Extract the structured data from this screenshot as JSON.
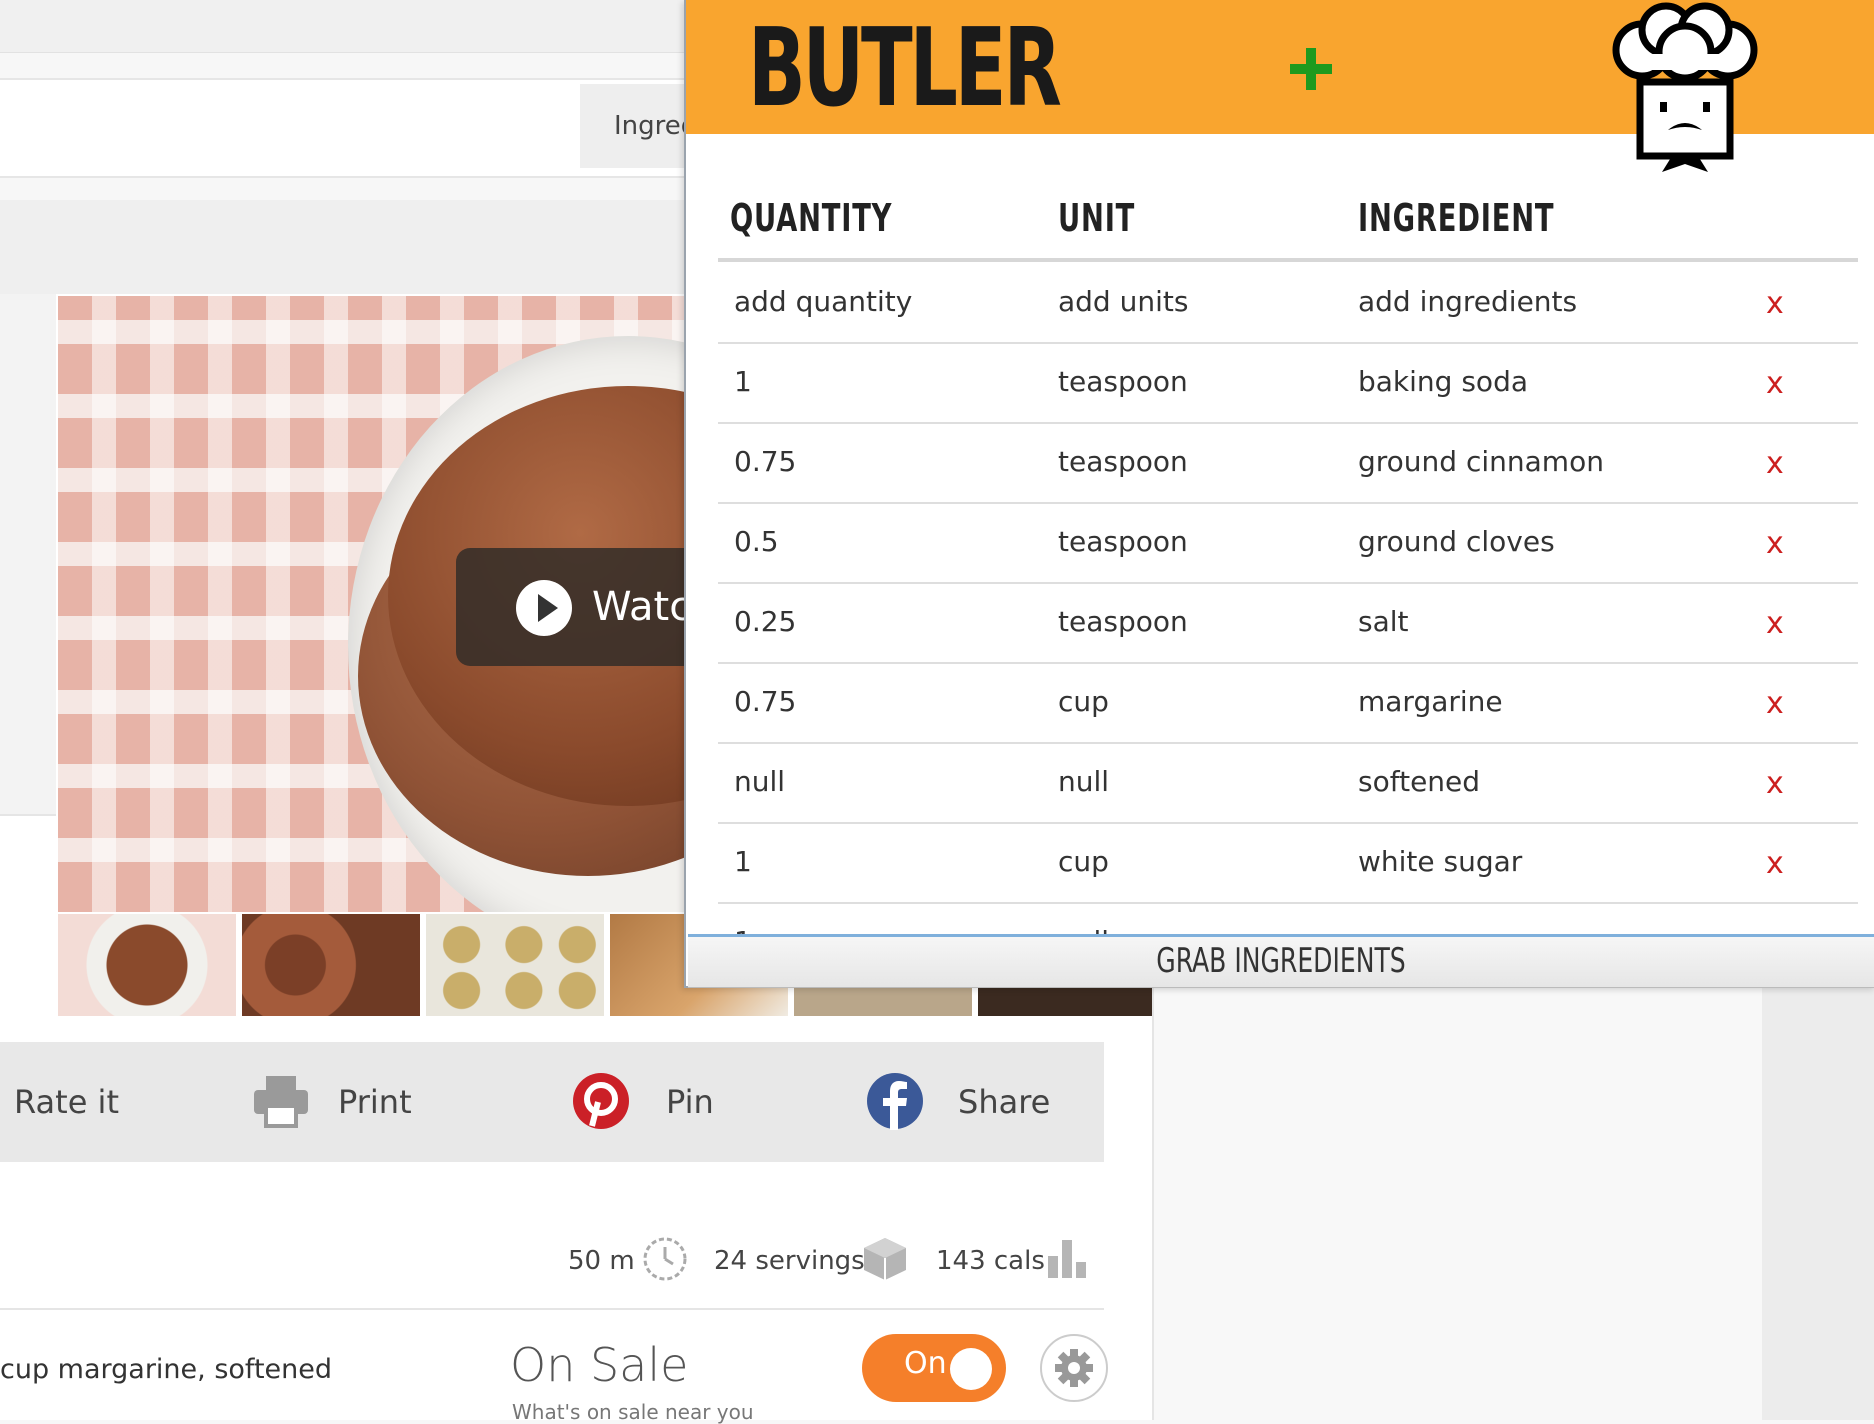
{
  "page": {
    "ingredients_tab": "Ingred",
    "video_button": "Watch",
    "actions": [
      {
        "label": "Rate it"
      },
      {
        "label": "Print"
      },
      {
        "label": "Pin"
      },
      {
        "label": "Share"
      }
    ],
    "stats": {
      "time": "50 m",
      "servings": "24 servings",
      "calories": "143 cals"
    },
    "ingredient_line": "cup margarine, softened",
    "on_sale": {
      "title": "On Sale",
      "subtitle": "What's on sale near you",
      "toggle_label": "On",
      "toggle_state": "on"
    }
  },
  "butler": {
    "title": "BUTLER",
    "add_icon": "plus-icon",
    "columns": {
      "quantity": "QUANTITY",
      "unit": "UNIT",
      "ingredient": "INGREDIENT"
    },
    "delete_label": "x",
    "rows": [
      {
        "quantity": "add quantity",
        "unit": "add units",
        "ingredient": "add ingredients"
      },
      {
        "quantity": "1",
        "unit": "teaspoon",
        "ingredient": "baking soda"
      },
      {
        "quantity": "0.75",
        "unit": "teaspoon",
        "ingredient": "ground cinnamon"
      },
      {
        "quantity": "0.5",
        "unit": "teaspoon",
        "ingredient": "ground cloves"
      },
      {
        "quantity": "0.25",
        "unit": "teaspoon",
        "ingredient": "salt"
      },
      {
        "quantity": "0.75",
        "unit": "cup",
        "ingredient": "margarine"
      },
      {
        "quantity": "null",
        "unit": "null",
        "ingredient": "softened"
      },
      {
        "quantity": "1",
        "unit": "cup",
        "ingredient": "white sugar"
      },
      {
        "quantity": "1",
        "unit": "null",
        "ingredient": "egg"
      }
    ],
    "grab_button": "GRAB INGREDIENTS",
    "colors": {
      "header": "#f9a52f",
      "delete": "#cc1f1f",
      "add": "#1e9a1e"
    }
  }
}
